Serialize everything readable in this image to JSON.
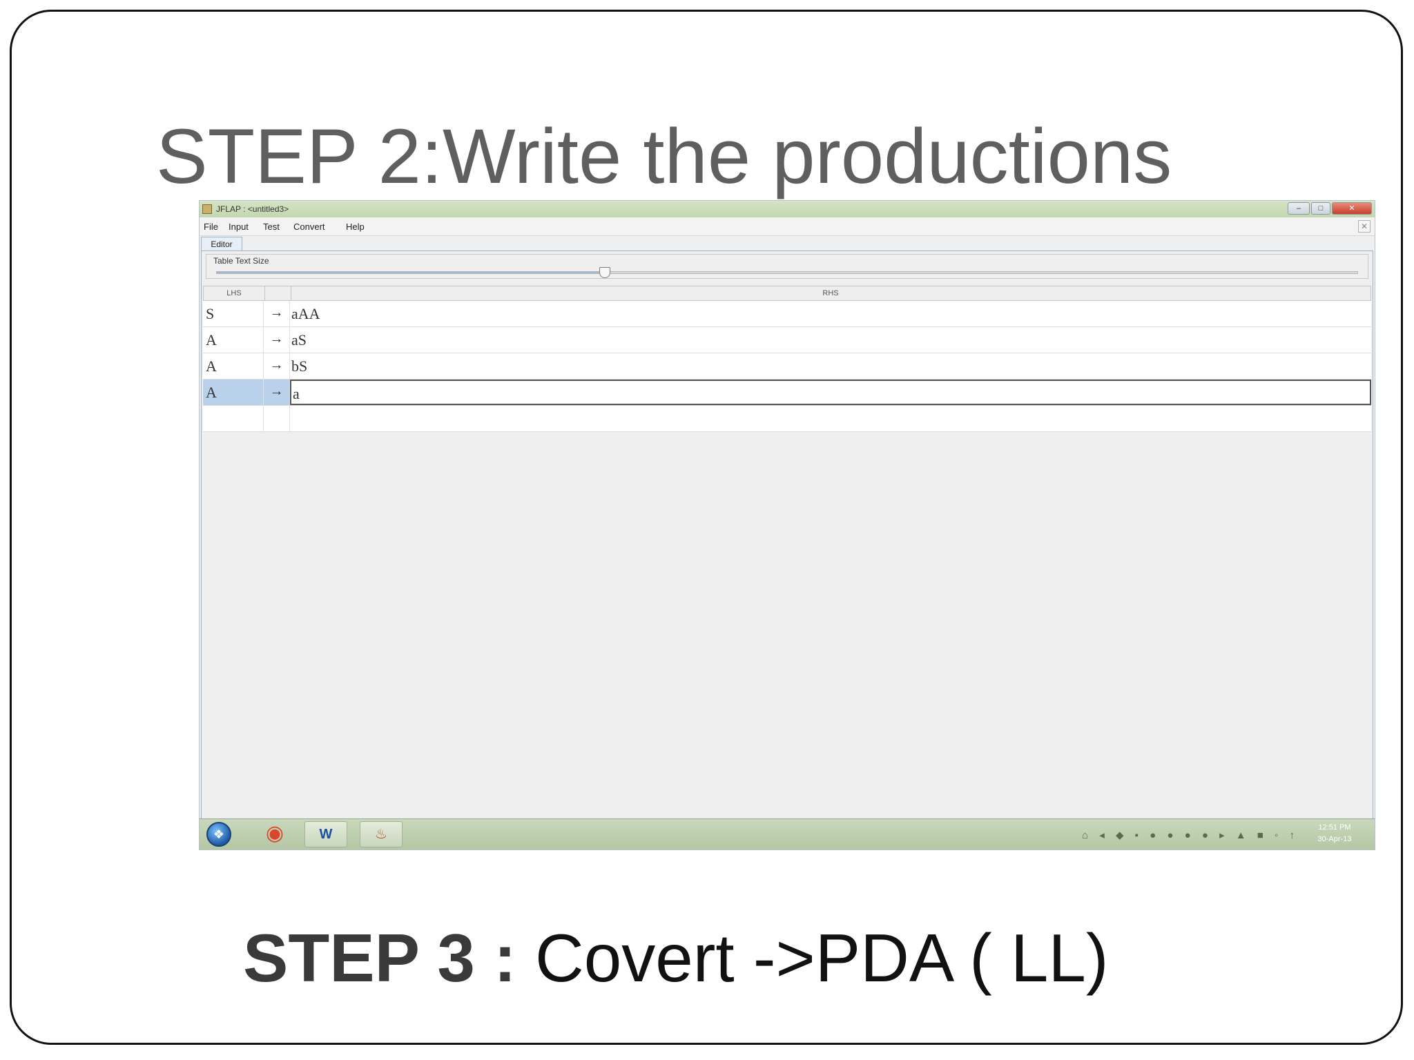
{
  "slide": {
    "title": "STEP 2:Write the productions",
    "caption_bold": "STEP 3 :",
    "caption_rest": " Covert ->PDA ( LL)"
  },
  "window": {
    "title": "JFLAP : <untitled3>",
    "min_glyph": "–",
    "max_glyph": "□",
    "close_glyph": "✕"
  },
  "menu": {
    "items": [
      "File",
      "Input",
      "Test",
      "Convert",
      "Help"
    ],
    "close_doc_glyph": "✕"
  },
  "tab": {
    "label": "Editor"
  },
  "slider": {
    "label": "Table Text Size",
    "level_fraction": 0.34
  },
  "table": {
    "headers": {
      "lhs": "LHS",
      "rhs": "RHS"
    },
    "arrow": "→",
    "rows": [
      {
        "lhs": "S",
        "rhs": "aAA"
      },
      {
        "lhs": "A",
        "rhs": "aS"
      },
      {
        "lhs": "A",
        "rhs": "bS"
      },
      {
        "lhs": "A",
        "rhs": "a"
      },
      {
        "lhs": "",
        "rhs": ""
      }
    ],
    "selected_row": 3
  },
  "taskbar": {
    "start_glyph": "❖",
    "chrome_glyph": "◉",
    "word_glyph": "W",
    "java_glyph": "♨",
    "tray_glyphs": "⌂ ◂ ◆ ▪ ● ● ● ● ▸ ▲ ■ ◦ ↑",
    "clock_time": "12:51 PM",
    "clock_date": "30-Apr-13"
  },
  "colors": {
    "title_text": "#5f5f5f",
    "selected_row": "#b9d1ea",
    "taskbar": "#c9d8bc"
  }
}
